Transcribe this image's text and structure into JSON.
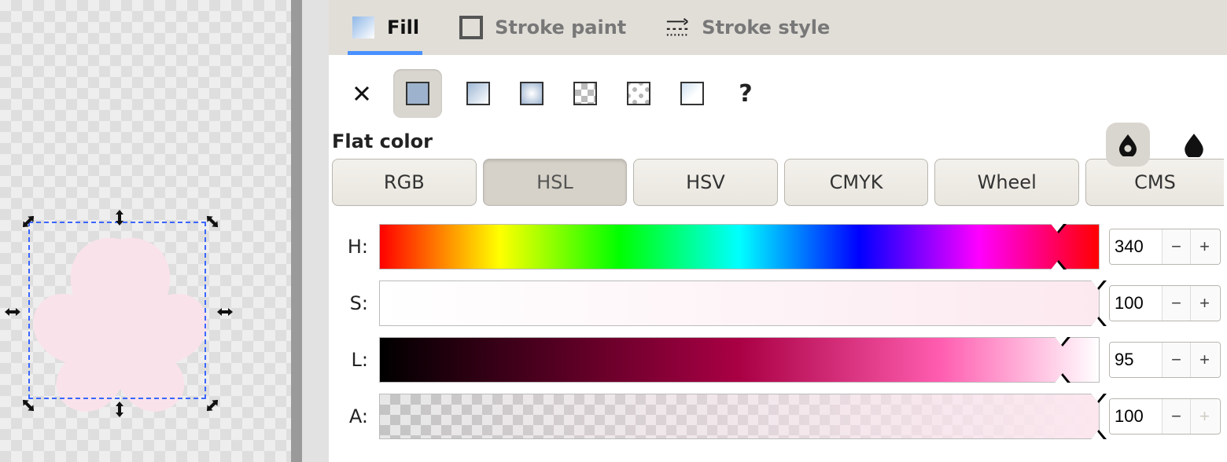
{
  "tabs": {
    "fill": "Fill",
    "stroke_paint": "Stroke paint",
    "stroke_style": "Stroke style"
  },
  "heading": "Flat color",
  "color_modes": {
    "rgb": "RGB",
    "hsl": "HSL",
    "hsv": "HSV",
    "cmyk": "CMYK",
    "wheel": "Wheel",
    "cms": "CMS"
  },
  "sliders": {
    "h": {
      "label": "H:",
      "value": "340",
      "pct": 94.4
    },
    "s": {
      "label": "S:",
      "value": "100",
      "pct": 100
    },
    "l": {
      "label": "L:",
      "value": "95",
      "pct": 95
    },
    "a": {
      "label": "A:",
      "value": "100",
      "pct": 100
    }
  },
  "paint_types": {
    "unknown": "?"
  },
  "colors": {
    "object_fill": "#fae2ea"
  }
}
